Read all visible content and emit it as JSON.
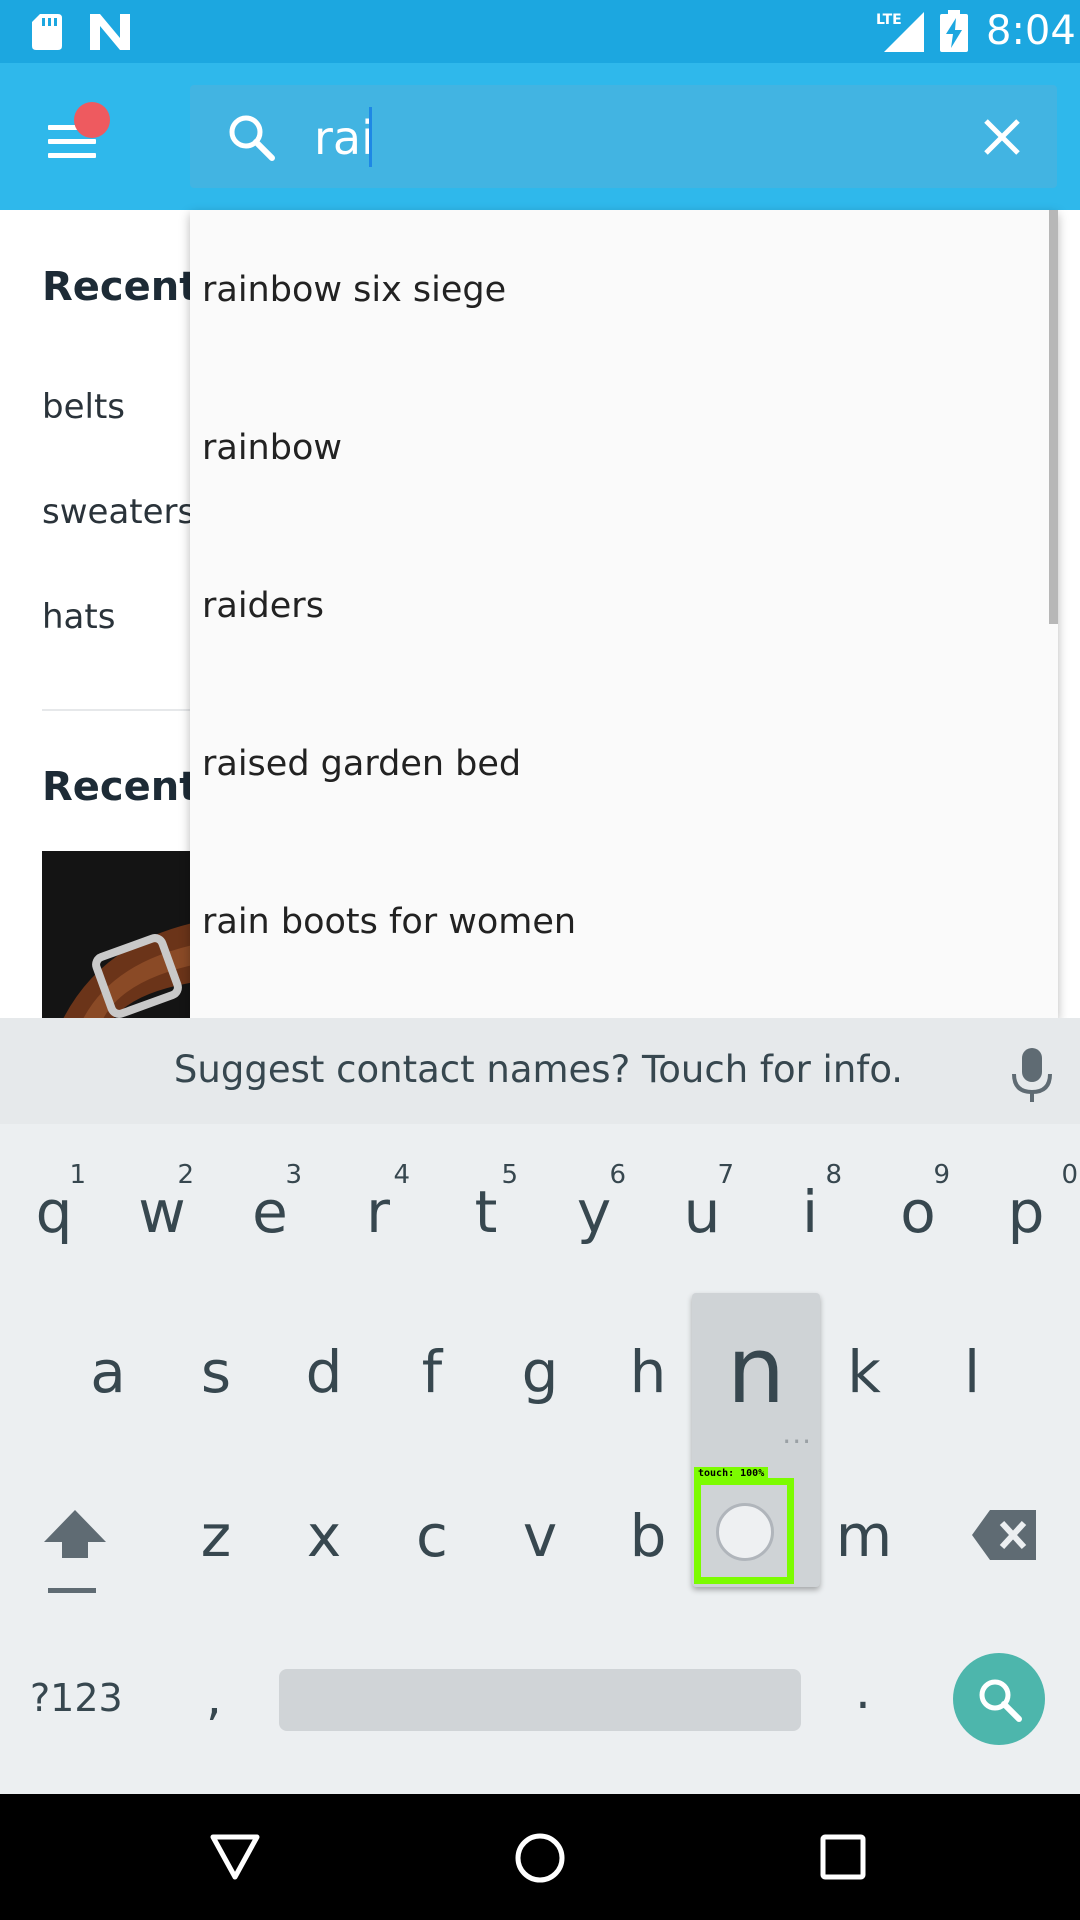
{
  "status_bar": {
    "time": "8:04",
    "network": "LTE",
    "icons": [
      "sd-card-icon",
      "n-logo-icon",
      "lte-signal-icon",
      "battery-charging-icon"
    ]
  },
  "search": {
    "query": "rai",
    "icons": [
      "search-icon",
      "close-icon"
    ]
  },
  "page": {
    "recent_searches_title": "Recent",
    "recent_searches": [
      "belts",
      "sweaters",
      "hats"
    ],
    "recently_viewed_title": "Recentl"
  },
  "suggestions": [
    "rainbow six siege",
    "rainbow",
    "raiders",
    "raised garden bed",
    "rain boots for women"
  ],
  "keyboard": {
    "suggestion_strip": "Suggest contact names? Touch for info.",
    "row1": [
      {
        "ch": "q",
        "hint": "1"
      },
      {
        "ch": "w",
        "hint": "2"
      },
      {
        "ch": "e",
        "hint": "3"
      },
      {
        "ch": "r",
        "hint": "4"
      },
      {
        "ch": "t",
        "hint": "5"
      },
      {
        "ch": "y",
        "hint": "6"
      },
      {
        "ch": "u",
        "hint": "7"
      },
      {
        "ch": "i",
        "hint": "8"
      },
      {
        "ch": "o",
        "hint": "9"
      },
      {
        "ch": "p",
        "hint": "0"
      }
    ],
    "row2": [
      "a",
      "s",
      "d",
      "f",
      "g",
      "h",
      "",
      "k",
      "l"
    ],
    "row3": [
      "z",
      "x",
      "c",
      "v",
      "b",
      "",
      "m"
    ],
    "popup_key": "n",
    "popup_more": "...",
    "symbols_key": "?123",
    "comma_key": ",",
    "period_key": ".",
    "touch_label": "touch: 100%",
    "colors": {
      "accent": "#4db6ac",
      "touch_box": "#7cfc00"
    }
  },
  "colors": {
    "status_bar": "#1ca7e0",
    "app_bar": "#2fb8eb",
    "notification_dot": "#ee5a5f"
  }
}
